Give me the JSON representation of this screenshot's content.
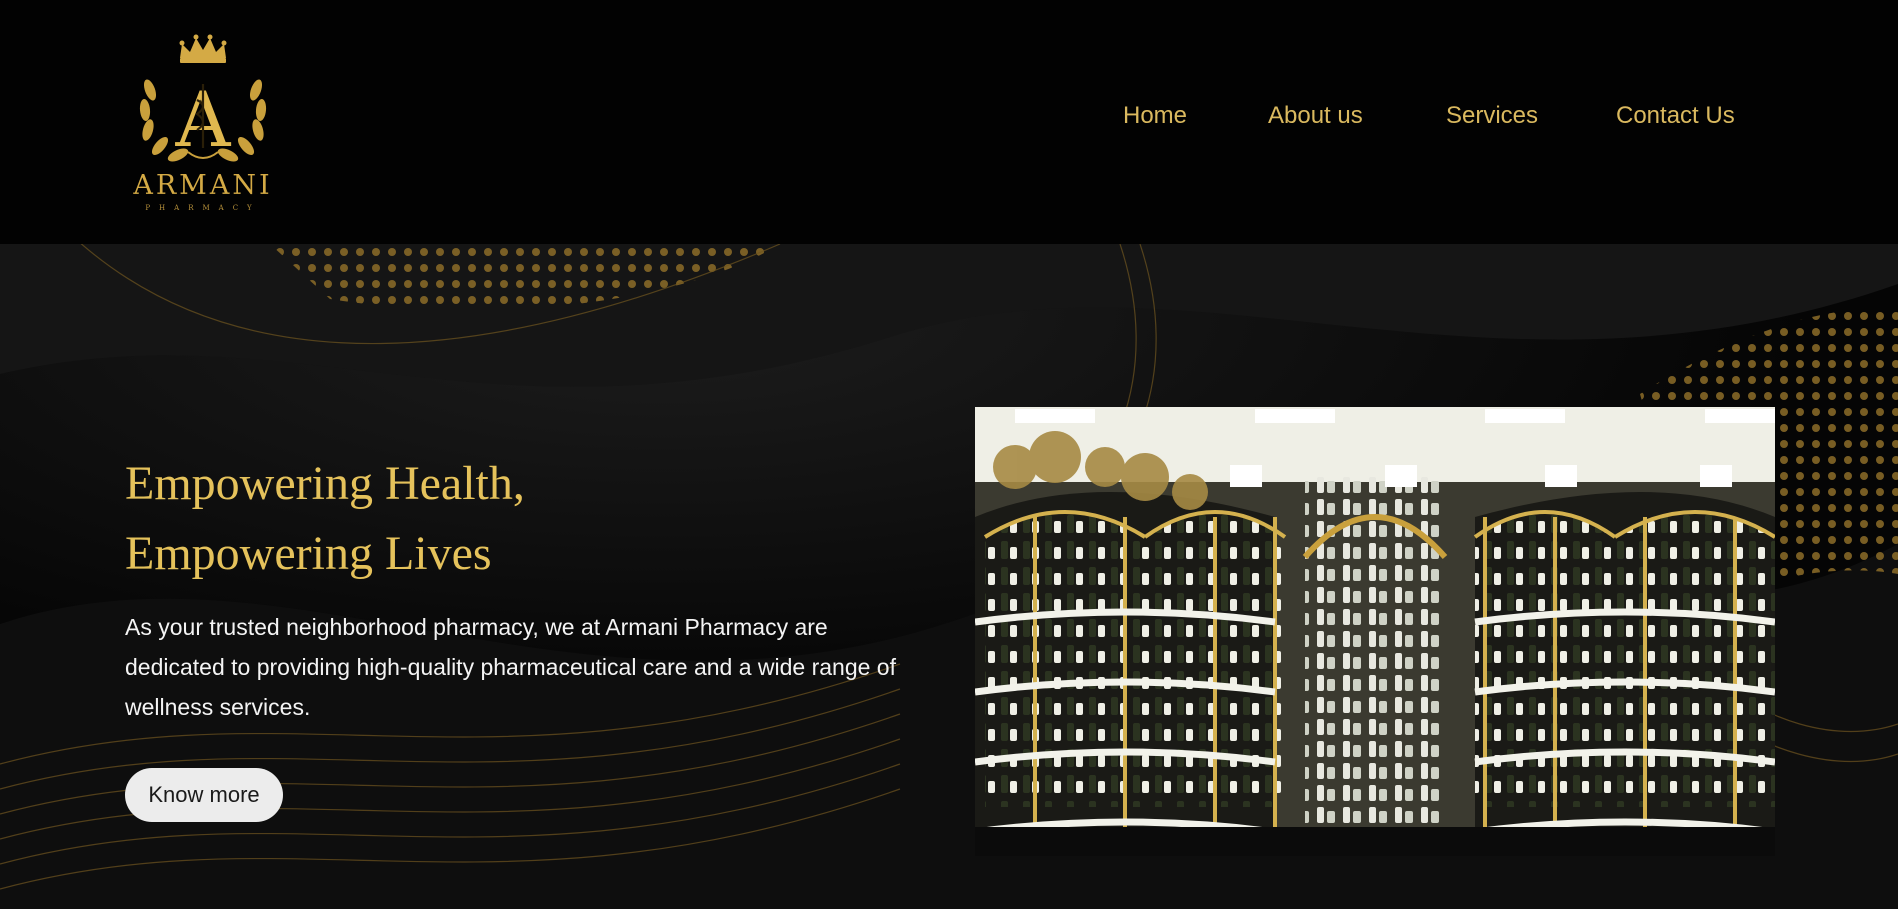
{
  "brand": {
    "name": "ARMANI",
    "tagline": "PHARMACY",
    "monogram": "A",
    "logo_icon": "crown-laurel-caduceus-icon"
  },
  "nav": {
    "items": [
      {
        "label": "Home"
      },
      {
        "label": "About us"
      },
      {
        "label": "Services"
      },
      {
        "label": "Contact Us"
      }
    ]
  },
  "hero": {
    "headline": [
      "Empowering Health,",
      "Empowering Lives"
    ],
    "intro": "As your trusted neighborhood pharmacy, we at Armani Pharmacy are dedicated to providing high-quality pharmaceutical care and a wide range of wellness services.",
    "cta_label": "Know more",
    "image_icon": "pharmacy-shelves-photo"
  },
  "colors": {
    "background": "#000000",
    "gold": "#d4aa45",
    "nav_gold": "#dab95f",
    "headline_gold": "#e5c25b",
    "body_text": "#f4f4f4",
    "button_bg": "#ececec"
  }
}
